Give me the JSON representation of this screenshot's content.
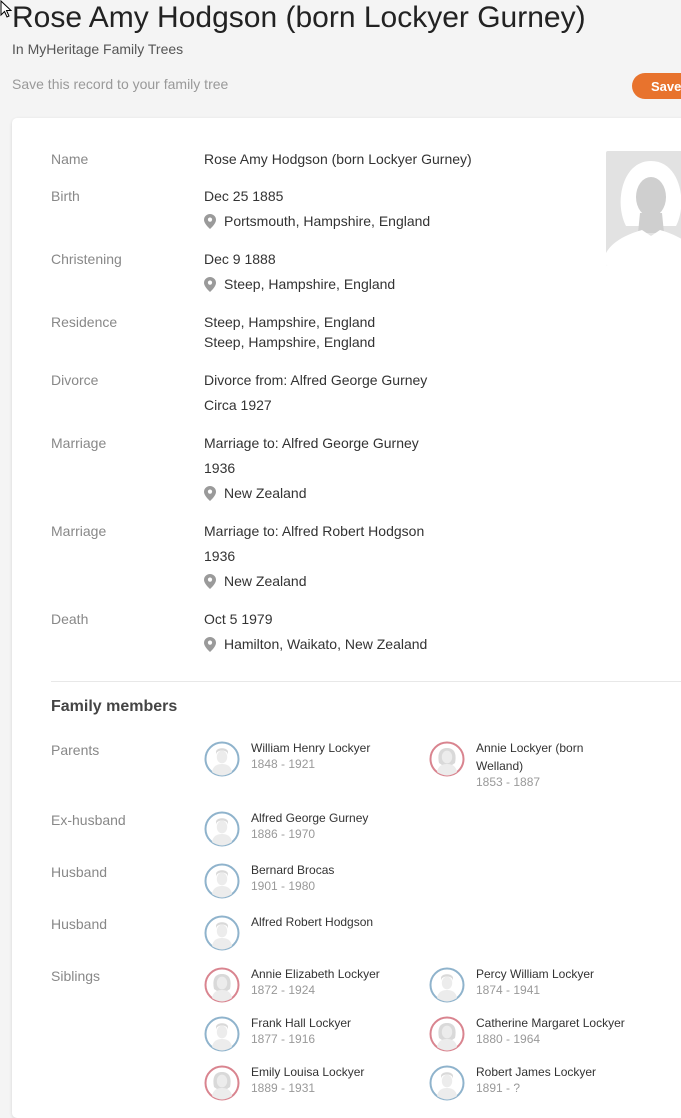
{
  "header": {
    "title": "Rose Amy Hodgson (born Lockyer Gurney)",
    "subtitle": "In MyHeritage Family Trees",
    "save_prompt": "Save this record to your family tree",
    "save_label": "Save"
  },
  "record": {
    "name_label": "Name",
    "name_value": "Rose Amy Hodgson (born Lockyer Gurney)",
    "birth_label": "Birth",
    "birth_date": "Dec 25 1885",
    "birth_place": "Portsmouth, Hampshire, England",
    "christening_label": "Christening",
    "christening_date": "Dec 9 1888",
    "christening_place": "Steep, Hampshire, England",
    "residence_label": "Residence",
    "residence_1": "Steep, Hampshire, England",
    "residence_2": "Steep, Hampshire, England",
    "divorce_label": "Divorce",
    "divorce_from": "Divorce from: Alfred George Gurney",
    "divorce_date": "Circa 1927",
    "marriage1_label": "Marriage",
    "marriage1_to": "Marriage to: Alfred George Gurney",
    "marriage1_date": "1936",
    "marriage1_place": "New Zealand",
    "marriage2_label": "Marriage",
    "marriage2_to": "Marriage to: Alfred Robert Hodgson",
    "marriage2_date": "1936",
    "marriage2_place": "New Zealand",
    "death_label": "Death",
    "death_date": "Oct 5 1979",
    "death_place": "Hamilton, Waikato, New Zealand"
  },
  "family": {
    "title": "Family members",
    "parents_label": "Parents",
    "exhusband_label": "Ex-husband",
    "husband1_label": "Husband",
    "husband2_label": "Husband",
    "siblings_label": "Siblings",
    "parents": [
      {
        "name": "William Henry Lockyer",
        "years": "1848 - 1921",
        "gender": "male"
      },
      {
        "name": "Annie Lockyer (born Welland)",
        "years": "1853 - 1887",
        "gender": "female"
      }
    ],
    "exhusband": {
      "name": "Alfred George Gurney",
      "years": "1886 - 1970",
      "gender": "male"
    },
    "husband1": {
      "name": "Bernard Brocas",
      "years": "1901 - 1980",
      "gender": "male"
    },
    "husband2": {
      "name": "Alfred Robert Hodgson",
      "gender": "male"
    },
    "siblings": [
      {
        "name": "Annie Elizabeth Lockyer",
        "years": "1872 - 1924",
        "gender": "female"
      },
      {
        "name": "Percy William Lockyer",
        "years": "1874 - 1941",
        "gender": "male"
      },
      {
        "name": "Frank Hall Lockyer",
        "years": "1877 - 1916",
        "gender": "male"
      },
      {
        "name": "Catherine Margaret Lockyer",
        "years": "1880 - 1964",
        "gender": "female"
      },
      {
        "name": "Emily Louisa Lockyer",
        "years": "1889 - 1931",
        "gender": "female"
      },
      {
        "name": "Robert James Lockyer",
        "years": "1891 - ?",
        "gender": "male"
      }
    ]
  },
  "colors": {
    "accent": "#e8732d",
    "male_avatar": "#8fb3cc",
    "female_avatar": "#d9848f"
  }
}
